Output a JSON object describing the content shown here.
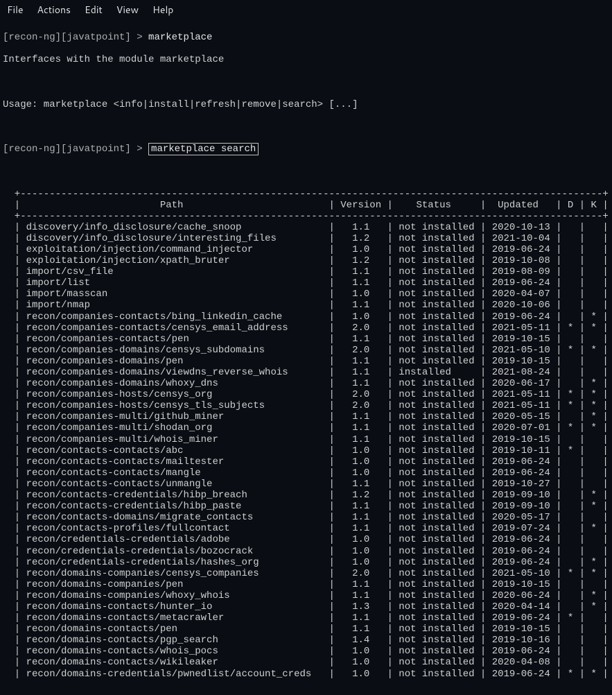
{
  "menu": {
    "file": "File",
    "actions": "Actions",
    "edit": "Edit",
    "view": "View",
    "help": "Help"
  },
  "prompt": {
    "ctx": "[recon-ng][javatpoint] ",
    "caret": "> ",
    "cmd1": "marketplace",
    "cmd2": "marketplace search",
    "iface": "Interfaces with the module marketplace",
    "usage": "Usage: marketplace <info|install|refresh|remove|search> [...]"
  },
  "headers": {
    "path": "Path",
    "version": "Version",
    "status": "Status",
    "updated": "Updated",
    "d": "D",
    "k": "K"
  },
  "rows": [
    {
      "path": "discovery/info_disclosure/cache_snoop",
      "version": "1.1",
      "status": "not installed",
      "updated": "2020-10-13",
      "d": "",
      "k": ""
    },
    {
      "path": "discovery/info_disclosure/interesting_files",
      "version": "1.2",
      "status": "not installed",
      "updated": "2021-10-04",
      "d": "",
      "k": ""
    },
    {
      "path": "exploitation/injection/command_injector",
      "version": "1.0",
      "status": "not installed",
      "updated": "2019-06-24",
      "d": "",
      "k": ""
    },
    {
      "path": "exploitation/injection/xpath_bruter",
      "version": "1.2",
      "status": "not installed",
      "updated": "2019-10-08",
      "d": "",
      "k": ""
    },
    {
      "path": "import/csv_file",
      "version": "1.1",
      "status": "not installed",
      "updated": "2019-08-09",
      "d": "",
      "k": ""
    },
    {
      "path": "import/list",
      "version": "1.1",
      "status": "not installed",
      "updated": "2019-06-24",
      "d": "",
      "k": ""
    },
    {
      "path": "import/masscan",
      "version": "1.0",
      "status": "not installed",
      "updated": "2020-04-07",
      "d": "",
      "k": ""
    },
    {
      "path": "import/nmap",
      "version": "1.1",
      "status": "not installed",
      "updated": "2020-10-06",
      "d": "",
      "k": ""
    },
    {
      "path": "recon/companies-contacts/bing_linkedin_cache",
      "version": "1.0",
      "status": "not installed",
      "updated": "2019-06-24",
      "d": "",
      "k": "*"
    },
    {
      "path": "recon/companies-contacts/censys_email_address",
      "version": "2.0",
      "status": "not installed",
      "updated": "2021-05-11",
      "d": "*",
      "k": "*"
    },
    {
      "path": "recon/companies-contacts/pen",
      "version": "1.1",
      "status": "not installed",
      "updated": "2019-10-15",
      "d": "",
      "k": ""
    },
    {
      "path": "recon/companies-domains/censys_subdomains",
      "version": "2.0",
      "status": "not installed",
      "updated": "2021-05-10",
      "d": "*",
      "k": "*"
    },
    {
      "path": "recon/companies-domains/pen",
      "version": "1.1",
      "status": "not installed",
      "updated": "2019-10-15",
      "d": "",
      "k": ""
    },
    {
      "path": "recon/companies-domains/viewdns_reverse_whois",
      "version": "1.1",
      "status": "installed",
      "updated": "2021-08-24",
      "d": "",
      "k": ""
    },
    {
      "path": "recon/companies-domains/whoxy_dns",
      "version": "1.1",
      "status": "not installed",
      "updated": "2020-06-17",
      "d": "",
      "k": "*"
    },
    {
      "path": "recon/companies-hosts/censys_org",
      "version": "2.0",
      "status": "not installed",
      "updated": "2021-05-11",
      "d": "*",
      "k": "*"
    },
    {
      "path": "recon/companies-hosts/censys_tls_subjects",
      "version": "2.0",
      "status": "not installed",
      "updated": "2021-05-11",
      "d": "*",
      "k": "*"
    },
    {
      "path": "recon/companies-multi/github_miner",
      "version": "1.1",
      "status": "not installed",
      "updated": "2020-05-15",
      "d": "",
      "k": "*"
    },
    {
      "path": "recon/companies-multi/shodan_org",
      "version": "1.1",
      "status": "not installed",
      "updated": "2020-07-01",
      "d": "*",
      "k": "*"
    },
    {
      "path": "recon/companies-multi/whois_miner",
      "version": "1.1",
      "status": "not installed",
      "updated": "2019-10-15",
      "d": "",
      "k": ""
    },
    {
      "path": "recon/contacts-contacts/abc",
      "version": "1.0",
      "status": "not installed",
      "updated": "2019-10-11",
      "d": "*",
      "k": ""
    },
    {
      "path": "recon/contacts-contacts/mailtester",
      "version": "1.0",
      "status": "not installed",
      "updated": "2019-06-24",
      "d": "",
      "k": ""
    },
    {
      "path": "recon/contacts-contacts/mangle",
      "version": "1.0",
      "status": "not installed",
      "updated": "2019-06-24",
      "d": "",
      "k": ""
    },
    {
      "path": "recon/contacts-contacts/unmangle",
      "version": "1.1",
      "status": "not installed",
      "updated": "2019-10-27",
      "d": "",
      "k": ""
    },
    {
      "path": "recon/contacts-credentials/hibp_breach",
      "version": "1.2",
      "status": "not installed",
      "updated": "2019-09-10",
      "d": "",
      "k": "*"
    },
    {
      "path": "recon/contacts-credentials/hibp_paste",
      "version": "1.1",
      "status": "not installed",
      "updated": "2019-09-10",
      "d": "",
      "k": "*"
    },
    {
      "path": "recon/contacts-domains/migrate_contacts",
      "version": "1.1",
      "status": "not installed",
      "updated": "2020-05-17",
      "d": "",
      "k": ""
    },
    {
      "path": "recon/contacts-profiles/fullcontact",
      "version": "1.1",
      "status": "not installed",
      "updated": "2019-07-24",
      "d": "",
      "k": "*"
    },
    {
      "path": "recon/credentials-credentials/adobe",
      "version": "1.0",
      "status": "not installed",
      "updated": "2019-06-24",
      "d": "",
      "k": ""
    },
    {
      "path": "recon/credentials-credentials/bozocrack",
      "version": "1.0",
      "status": "not installed",
      "updated": "2019-06-24",
      "d": "",
      "k": ""
    },
    {
      "path": "recon/credentials-credentials/hashes_org",
      "version": "1.0",
      "status": "not installed",
      "updated": "2019-06-24",
      "d": "",
      "k": "*"
    },
    {
      "path": "recon/domains-companies/censys_companies",
      "version": "2.0",
      "status": "not installed",
      "updated": "2021-05-10",
      "d": "*",
      "k": "*"
    },
    {
      "path": "recon/domains-companies/pen",
      "version": "1.1",
      "status": "not installed",
      "updated": "2019-10-15",
      "d": "",
      "k": ""
    },
    {
      "path": "recon/domains-companies/whoxy_whois",
      "version": "1.1",
      "status": "not installed",
      "updated": "2020-06-24",
      "d": "",
      "k": "*"
    },
    {
      "path": "recon/domains-contacts/hunter_io",
      "version": "1.3",
      "status": "not installed",
      "updated": "2020-04-14",
      "d": "",
      "k": "*"
    },
    {
      "path": "recon/domains-contacts/metacrawler",
      "version": "1.1",
      "status": "not installed",
      "updated": "2019-06-24",
      "d": "*",
      "k": ""
    },
    {
      "path": "recon/domains-contacts/pen",
      "version": "1.1",
      "status": "not installed",
      "updated": "2019-10-15",
      "d": "",
      "k": ""
    },
    {
      "path": "recon/domains-contacts/pgp_search",
      "version": "1.4",
      "status": "not installed",
      "updated": "2019-10-16",
      "d": "",
      "k": ""
    },
    {
      "path": "recon/domains-contacts/whois_pocs",
      "version": "1.0",
      "status": "not installed",
      "updated": "2019-06-24",
      "d": "",
      "k": ""
    },
    {
      "path": "recon/domains-contacts/wikileaker",
      "version": "1.0",
      "status": "not installed",
      "updated": "2020-04-08",
      "d": "",
      "k": ""
    },
    {
      "path": "recon/domains-credentials/pwnedlist/account_creds",
      "version": "1.0",
      "status": "not installed",
      "updated": "2019-06-24",
      "d": "*",
      "k": "*"
    }
  ]
}
